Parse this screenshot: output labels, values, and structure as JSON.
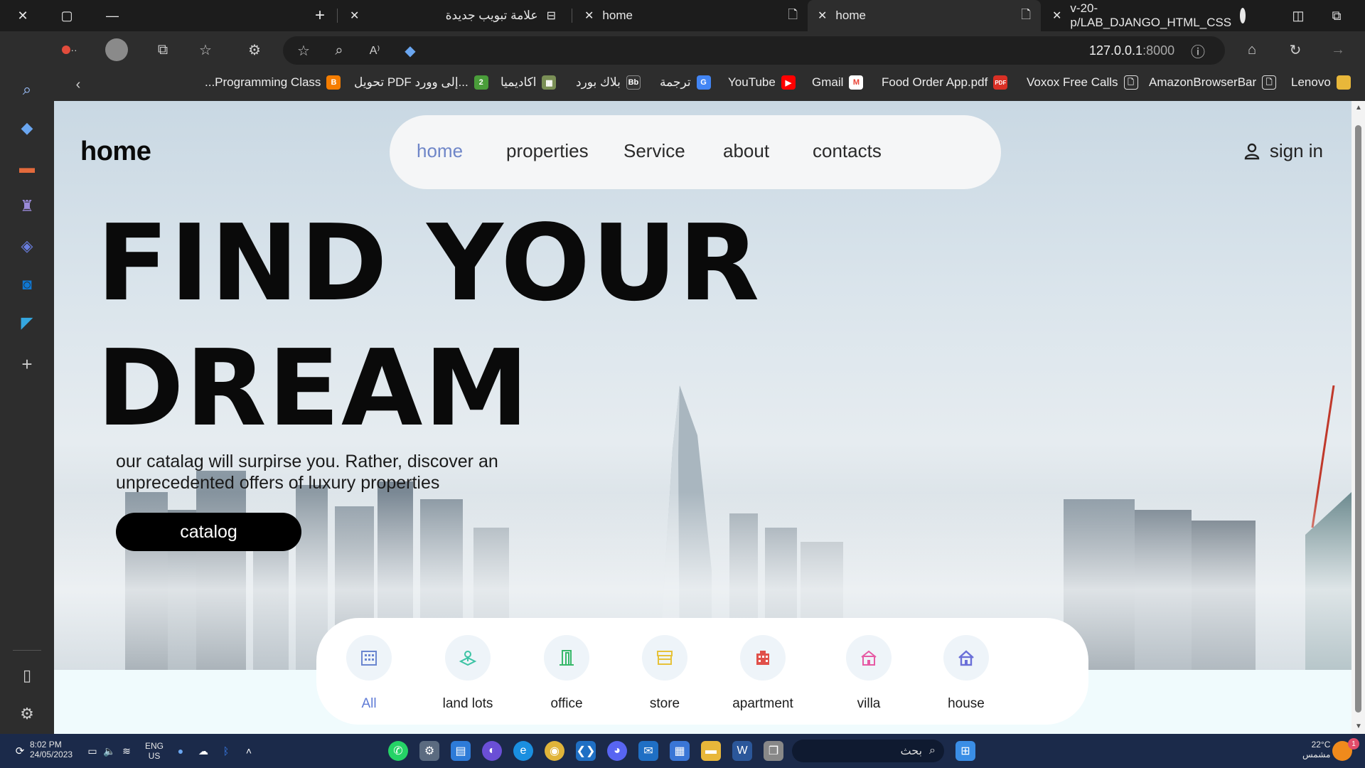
{
  "browser": {
    "tabs": [
      {
        "title": "علامة تبويب جديدة",
        "active": false
      },
      {
        "title": "home",
        "active": false
      },
      {
        "title": "home",
        "active": true
      },
      {
        "title": "v-20-p/LAB_DJANGO_HTML_CSS",
        "active": false
      }
    ],
    "url_host": "127.0.0.1",
    "url_port": ":8000",
    "favorites": [
      {
        "label": "...Programming Class",
        "icon": "blogger-icon",
        "color": "#f57d00"
      },
      {
        "label": "تحويل PDF إلى وورد...",
        "icon": "pdf-convert-icon",
        "color": "#4a9d3a"
      },
      {
        "label": "اكاديميا",
        "icon": "academia-icon",
        "color": "#7a8f56"
      },
      {
        "label": "بلاك بورد",
        "icon": "blackboard-icon",
        "color": "#333333"
      },
      {
        "label": "ترجمة",
        "icon": "google-translate-icon",
        "color": "#4285f4"
      },
      {
        "label": "YouTube",
        "icon": "youtube-icon",
        "color": "#ff0000"
      },
      {
        "label": "Gmail",
        "icon": "gmail-icon",
        "color": "#ea4335"
      },
      {
        "label": "Food Order App.pdf",
        "icon": "pdf-icon",
        "color": "#d93025"
      },
      {
        "label": "Voxox Free Calls",
        "icon": "page-icon",
        "color": "#2d2d2d"
      },
      {
        "label": "AmazonBrowserBar",
        "icon": "page-icon",
        "color": "#2d2d2d"
      },
      {
        "label": "Lenovo",
        "icon": "folder-icon",
        "color": "#e8b73a"
      }
    ]
  },
  "site": {
    "logo": "home",
    "nav": [
      {
        "label": "home",
        "active": true
      },
      {
        "label": "properties",
        "active": false
      },
      {
        "label": "Service",
        "active": false
      },
      {
        "label": "about",
        "active": false
      },
      {
        "label": "contacts",
        "active": false
      }
    ],
    "signin_label": "sign in",
    "headline_line1": "FIND YOUR",
    "headline_line2": "DREAM",
    "subtitle": "our catalag will surpirse you. Rather, discover an unprecedented offers of luxury properties",
    "catalog_label": "catalog",
    "categories": [
      {
        "label": "All",
        "icon": "building-icon",
        "color": "#6a86d0",
        "active": true
      },
      {
        "label": "land lots",
        "icon": "land-pin-icon",
        "color": "#3cc3a4",
        "active": false
      },
      {
        "label": "office",
        "icon": "office-door-icon",
        "color": "#38b86a",
        "active": false
      },
      {
        "label": "store",
        "icon": "store-icon",
        "color": "#e6c23a",
        "active": false
      },
      {
        "label": "apartment",
        "icon": "apartment-icon",
        "color": "#e0504a",
        "active": false
      },
      {
        "label": "villa",
        "icon": "villa-icon",
        "color": "#e65aa4",
        "active": false
      },
      {
        "label": "house",
        "icon": "house-icon",
        "color": "#6a6fd8",
        "active": false
      }
    ]
  },
  "taskbar": {
    "time": "8:02 PM",
    "date": "24/05/2023",
    "lang_top": "ENG",
    "lang_bottom": "US",
    "search_placeholder": "بحث",
    "weather_temp": "22°C",
    "weather_desc": "مشمس",
    "notification_count": "1"
  }
}
